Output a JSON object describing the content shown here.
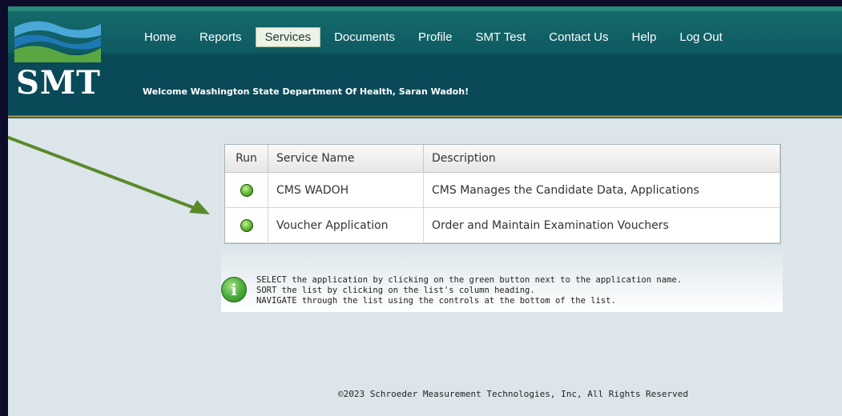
{
  "logo": {
    "text": "SMT"
  },
  "nav": {
    "items": [
      {
        "label": "Home"
      },
      {
        "label": "Reports"
      },
      {
        "label": "Services",
        "active": true
      },
      {
        "label": "Documents"
      },
      {
        "label": "Profile"
      },
      {
        "label": "SMT Test"
      },
      {
        "label": "Contact Us"
      },
      {
        "label": "Help"
      },
      {
        "label": "Log Out"
      }
    ]
  },
  "welcome": "Welcome Washington State Department Of Health, Saran Wadoh!",
  "table": {
    "headers": {
      "run": "Run",
      "name": "Service Name",
      "description": "Description"
    },
    "rows": [
      {
        "name": "CMS WADOH",
        "description": "CMS Manages the Candidate Data, Applications"
      },
      {
        "name": "Voucher Application",
        "description": "Order and Maintain Examination Vouchers"
      }
    ]
  },
  "info": {
    "lines": [
      "SELECT the application by clicking on the green button next to the application name.",
      "SORT the list by clicking on the list's column heading.",
      "NAVIGATE through the list using the controls at the bottom of the list."
    ]
  },
  "footer": "©2023 Schroeder Measurement Technologies, Inc, All Rights Reserved",
  "colors": {
    "header": "#0a4a58",
    "accent": "#2a8a7a",
    "arrow": "#5a8a2a",
    "run_button": "#6fbf3a"
  }
}
